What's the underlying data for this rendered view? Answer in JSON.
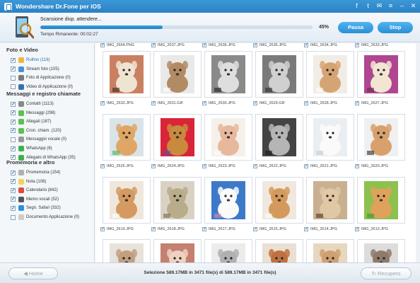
{
  "window": {
    "title": "Wondershare Dr.Fone per iOS",
    "controls": [
      "facebook-icon",
      "twitter-icon",
      "feedback-icon",
      "menu-icon",
      "minimize-icon",
      "close-icon"
    ]
  },
  "scan": {
    "status": "Scansione disp. attendere...",
    "remaining": "Tempo Rimanente: 00:02:27",
    "percent_label": "45%",
    "percent": 45,
    "pause_label": "Pausa",
    "stop_label": "Stop"
  },
  "sidebar": {
    "sections": [
      {
        "title": "Foto e Video",
        "items": [
          {
            "label": "Rullino (118)",
            "checked": true,
            "selected": true,
            "icon": "camera-roll-icon",
            "color": "#f2b43c"
          },
          {
            "label": "Stream foto (105)",
            "checked": true,
            "icon": "photo-stream-icon",
            "color": "#4a90d9"
          },
          {
            "label": "Foto di Applicazione (0)",
            "checked": false,
            "icon": "app-photo-icon",
            "color": "#7a7a7a"
          },
          {
            "label": "Video di Applicazione (0)",
            "checked": false,
            "icon": "app-video-icon",
            "color": "#3b6fb0"
          }
        ]
      },
      {
        "title": "Messaggi e registro chiamate",
        "items": [
          {
            "label": "Contatti (1113)",
            "checked": true,
            "icon": "contacts-icon",
            "color": "#8a8a8a"
          },
          {
            "label": "Messaggi (298)",
            "checked": true,
            "icon": "messages-icon",
            "color": "#5cc14f"
          },
          {
            "label": "Allegati (187)",
            "checked": true,
            "icon": "attachments-icon",
            "color": "#5cc14f"
          },
          {
            "label": "Cron. chiam. (120)",
            "checked": true,
            "icon": "call-history-icon",
            "color": "#5cc14f"
          },
          {
            "label": "Messaggio vocale (0)",
            "checked": false,
            "icon": "voicemail-icon",
            "color": "#999999"
          },
          {
            "label": "WhatsApp (6)",
            "checked": true,
            "icon": "whatsapp-icon",
            "color": "#3bb34a"
          },
          {
            "label": "Allegato di WhatsApp (35)",
            "checked": true,
            "icon": "whatsapp-attachment-icon",
            "color": "#3bb34a"
          }
        ]
      },
      {
        "title": "Promemoria e altro",
        "items": [
          {
            "label": "Promemoria (154)",
            "checked": true,
            "icon": "reminders-icon",
            "color": "#b0b0b0"
          },
          {
            "label": "Nota (108)",
            "checked": true,
            "icon": "notes-icon",
            "color": "#f3d256"
          },
          {
            "label": "Calendario (842)",
            "checked": true,
            "icon": "calendar-icon",
            "color": "#e04a3f"
          },
          {
            "label": "Memo vocali (52)",
            "checked": true,
            "icon": "voice-memo-icon",
            "color": "#555555"
          },
          {
            "label": "Segn. Safari (332)",
            "checked": true,
            "icon": "safari-icon",
            "color": "#2b8fe0"
          },
          {
            "label": "Documento Applicazione (0)",
            "checked": false,
            "icon": "app-document-icon",
            "color": "#cccccc"
          }
        ]
      }
    ]
  },
  "grid": {
    "top_labels": [
      "IMG_2664.PNG",
      "IMG_2637.JPG",
      "IMG_2636.JPG",
      "IMG_2635.JPG",
      "IMG_2634.JPG",
      "IMG_2633.JPG"
    ],
    "rows": [
      [
        {
          "label": "IMG_2632.JPG",
          "colors": [
            "#c98060",
            "#efe3d2",
            "#3b2a22"
          ]
        },
        {
          "label": "IMG_2631.GIF",
          "colors": [
            "#e9e9e9",
            "#b28a64",
            "#ffffff"
          ]
        },
        {
          "label": "IMG_2630.JPG",
          "colors": [
            "#8a8a8a",
            "#dedede",
            "#222222"
          ]
        },
        {
          "label": "IMG_2629.GIF",
          "colors": [
            "#7a7a7a",
            "#d0d0d0",
            "#303030"
          ]
        },
        {
          "label": "IMG_2628.JPG",
          "colors": [
            "#f1ede6",
            "#d6a473",
            "#ffffff"
          ]
        },
        {
          "label": "IMG_2627.JPG",
          "colors": [
            "#b0468f",
            "#f2e6d2",
            "#6b2a52"
          ]
        }
      ],
      [
        {
          "label": "IMG_2625.JPG",
          "colors": [
            "#d9e4e8",
            "#e0a665",
            "#4ab045"
          ]
        },
        {
          "label": "IMG_2624.JPG",
          "colors": [
            "#d9243a",
            "#c98a3e",
            "#3d5fb0"
          ]
        },
        {
          "label": "IMG_2623.JPG",
          "colors": [
            "#f6f0eb",
            "#e8b89c",
            "#ffffff"
          ]
        },
        {
          "label": "IMG_2622.JPG",
          "colors": [
            "#444444",
            "#b5b5b5",
            "#1a1a1a"
          ]
        },
        {
          "label": "IMG_2621.JPG",
          "colors": [
            "#e9eef3",
            "#fafafa",
            "#c4ccd3"
          ]
        },
        {
          "label": "IMG_2620.JPG",
          "colors": [
            "#eef0f2",
            "#d8a06b",
            "#2a2a2a"
          ]
        }
      ],
      [
        {
          "label": "IMG_2619.JPG",
          "colors": [
            "#efe7dc",
            "#d49a61",
            "#ffffff"
          ]
        },
        {
          "label": "IMG_2618.JPG",
          "colors": [
            "#d9d2c4",
            "#b8ac8a",
            "#6a6a5a"
          ]
        },
        {
          "label": "IMG_2617.JPG",
          "colors": [
            "#3c7ac9",
            "#fafafa",
            "#e28ab0"
          ]
        },
        {
          "label": "IMG_2615.JPG",
          "colors": [
            "#f0e8df",
            "#d39a5b",
            "#ffffff"
          ]
        },
        {
          "label": "IMG_2614.JPG",
          "colors": [
            "#c9b090",
            "#e0c8a4",
            "#4a3a2c"
          ]
        },
        {
          "label": "IMG_2613.JPG",
          "colors": [
            "#8cc04f",
            "#e0a25b",
            "#4d8c34"
          ]
        }
      ],
      [
        {
          "label": "",
          "colors": [
            "#e8e2dc",
            "#c0a080",
            "#ffffff"
          ]
        },
        {
          "label": "",
          "colors": [
            "#c48070",
            "#f0d0c0",
            "#603020"
          ]
        },
        {
          "label": "",
          "colors": [
            "#ececec",
            "#b0b0b0",
            "#ffffff"
          ]
        },
        {
          "label": "",
          "colors": [
            "#e9e0d4",
            "#c07040",
            "#3a3a3a"
          ]
        },
        {
          "label": "",
          "colors": [
            "#e6d8c0",
            "#d0a070",
            "#ffffff"
          ]
        },
        {
          "label": "",
          "colors": [
            "#dcdcdc",
            "#907a6a",
            "#ffffff"
          ]
        }
      ]
    ]
  },
  "footer": {
    "home_label": "Home",
    "recover_label": "Recupero",
    "status": "Selezione 589.17MB in 3471 file(s) di 589.17MB in 3471 file(s)"
  }
}
